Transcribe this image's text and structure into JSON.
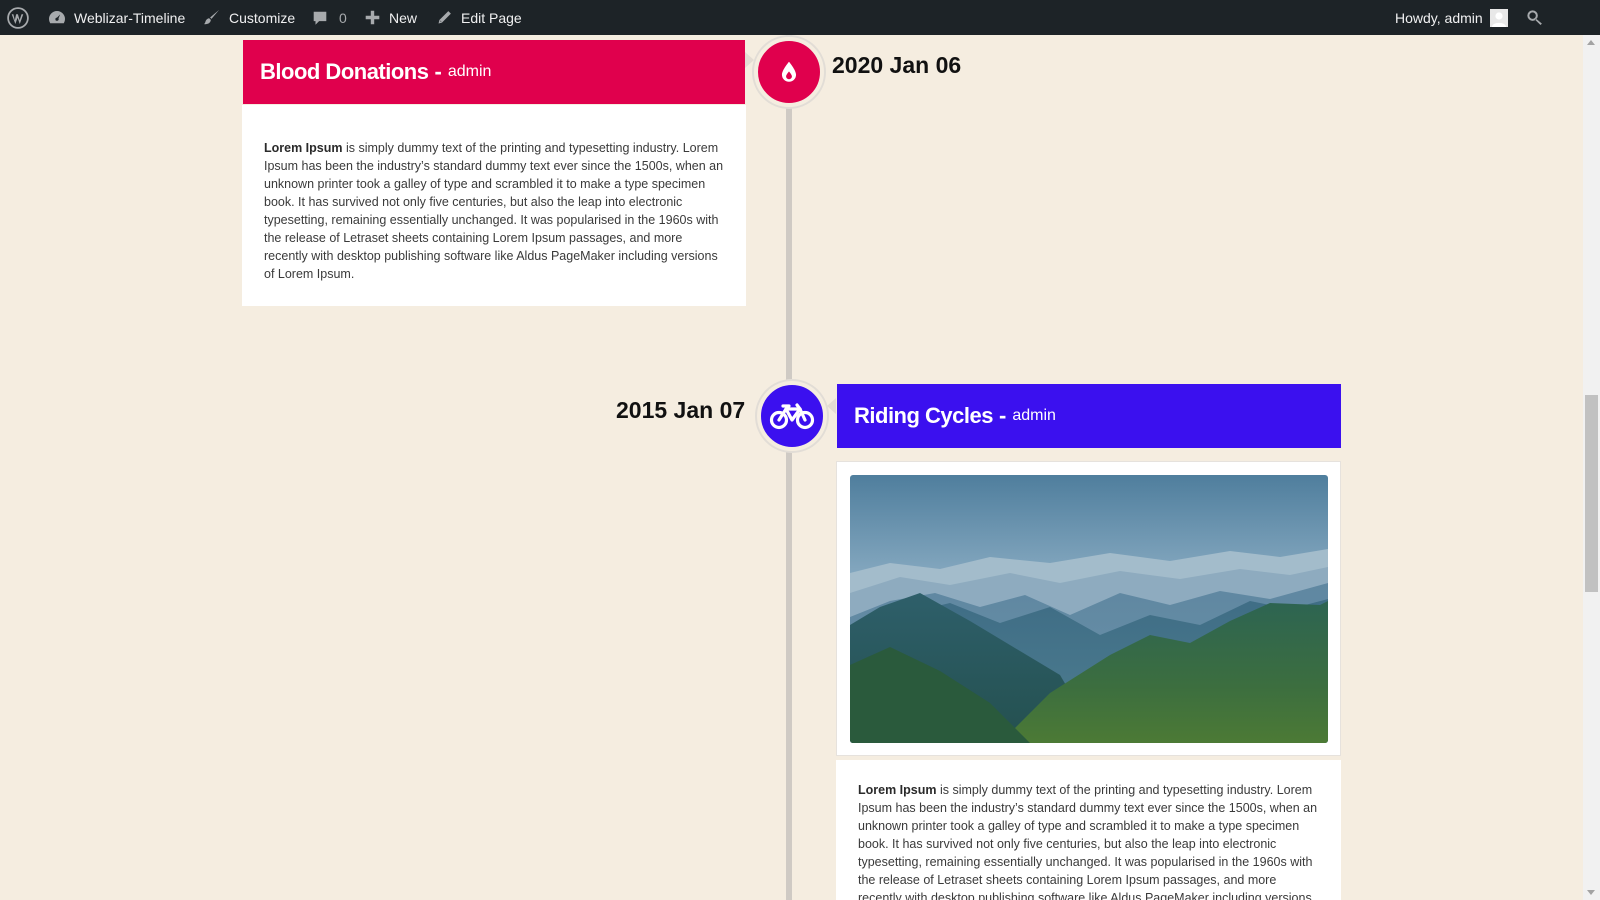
{
  "adminbar": {
    "site_name": "Weblizar-Timeline",
    "customize": "Customize",
    "comments_count": "0",
    "new": "New",
    "edit_page": "Edit Page",
    "howdy": "Howdy, admin"
  },
  "timeline": {
    "items": [
      {
        "title": "Blood Donations",
        "separator": "-",
        "author": "admin",
        "date": "2020 Jan 06",
        "icon": "blood-drop-icon",
        "color": "#e0004d",
        "body_bold": "Lorem Ipsum",
        "body_text": " is simply dummy text of the printing and typesetting industry. Lorem Ipsum has been the industry’s standard dummy text ever since the 1500s, when an unknown printer took a galley of type and scrambled it to make a type specimen book. It has survived not only five centuries, but also the leap into electronic typesetting, remaining essentially unchanged. It was popularised in the 1960s with the release of Letraset sheets containing Lorem Ipsum passages, and more recently with desktop publishing software like Aldus PageMaker including versions of Lorem Ipsum."
      },
      {
        "title": "Riding Cycles",
        "separator": "-",
        "author": "admin",
        "date": "2015 Jan 07",
        "icon": "bicycle-icon",
        "color": "#3b10ef",
        "image": "mountain-landscape",
        "body_bold": "Lorem Ipsum",
        "body_text": " is simply dummy text of the printing and typesetting industry. Lorem Ipsum has been the industry’s standard dummy text ever since the 1500s, when an unknown printer took a galley of type and scrambled it to make a type specimen book. It has survived not only five centuries, but also the leap into electronic typesetting, remaining essentially unchanged. It was popularised in the 1960s with the release of Letraset sheets containing Lorem Ipsum passages, and more recently with desktop publishing software like Aldus PageMaker including versions of Lorem Ipsum."
      }
    ]
  }
}
